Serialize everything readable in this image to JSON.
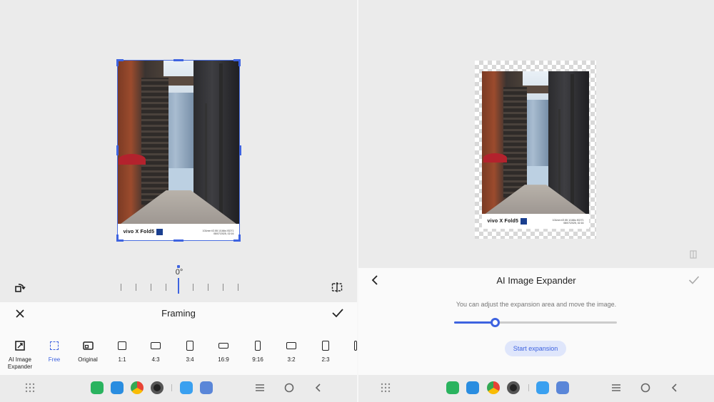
{
  "left": {
    "rotation_readout": "0°",
    "panel_title": "Framing",
    "ratios": [
      {
        "label": "AI Image\nExpander",
        "icon": "ai-expand-icon"
      },
      {
        "label": "Free",
        "icon": "free-crop-icon",
        "active": true
      },
      {
        "label": "Original",
        "icon": "original-ratio-icon"
      },
      {
        "label": "1:1",
        "icon": "ratio-1-1-icon"
      },
      {
        "label": "4:3",
        "icon": "ratio-4-3-icon"
      },
      {
        "label": "3:4",
        "icon": "ratio-3-4-icon"
      },
      {
        "label": "16:9",
        "icon": "ratio-16-9-icon"
      },
      {
        "label": "9:16",
        "icon": "ratio-9-16-icon"
      },
      {
        "label": "3:2",
        "icon": "ratio-3-2-icon"
      },
      {
        "label": "2:3",
        "icon": "ratio-2-3-icon"
      }
    ]
  },
  "photo": {
    "brand": "vivo X Fold5",
    "exif_line1": "101mm  f/2.55  1/166s  ISO71",
    "exif_line2": "08/07/2025, 02:16"
  },
  "right": {
    "title": "AI Image Expander",
    "hint": "You can adjust the expansion area and move the image.",
    "slider_value": 0.25,
    "start_label": "Start expansion"
  },
  "colors": {
    "accent": "#3e63e0",
    "panel_bg": "#fafafa",
    "canvas_bg": "#ebebeb"
  },
  "dock": {
    "apps": [
      "phone-icon",
      "messages-icon",
      "chrome-icon",
      "camera-icon",
      "gallery-icon",
      "notes-icon"
    ],
    "nav": [
      "menu-icon",
      "home-icon",
      "back-icon"
    ]
  }
}
